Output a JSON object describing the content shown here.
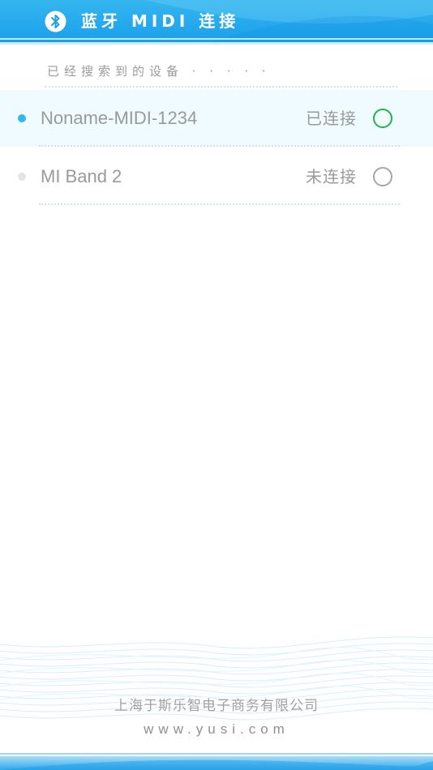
{
  "header": {
    "title": "蓝牙 MIDI 连接",
    "icon": "bluetooth-icon",
    "color": "#1aa0ea"
  },
  "section": {
    "label": "已经搜索到的设备 · · · · ·"
  },
  "devices": [
    {
      "name": "Noname-MIDI-1234",
      "status": "已连接",
      "connected": true,
      "dot_color": "#33b5ee",
      "radio_color": "#22b14c"
    },
    {
      "name": "MI Band 2",
      "status": "未连接",
      "connected": false,
      "dot_color": "#e4e4e4",
      "radio_color": "#a6a6a6"
    }
  ],
  "footer": {
    "company": "上海于斯乐智电子商务有限公司",
    "website": "www.yusi.com"
  }
}
